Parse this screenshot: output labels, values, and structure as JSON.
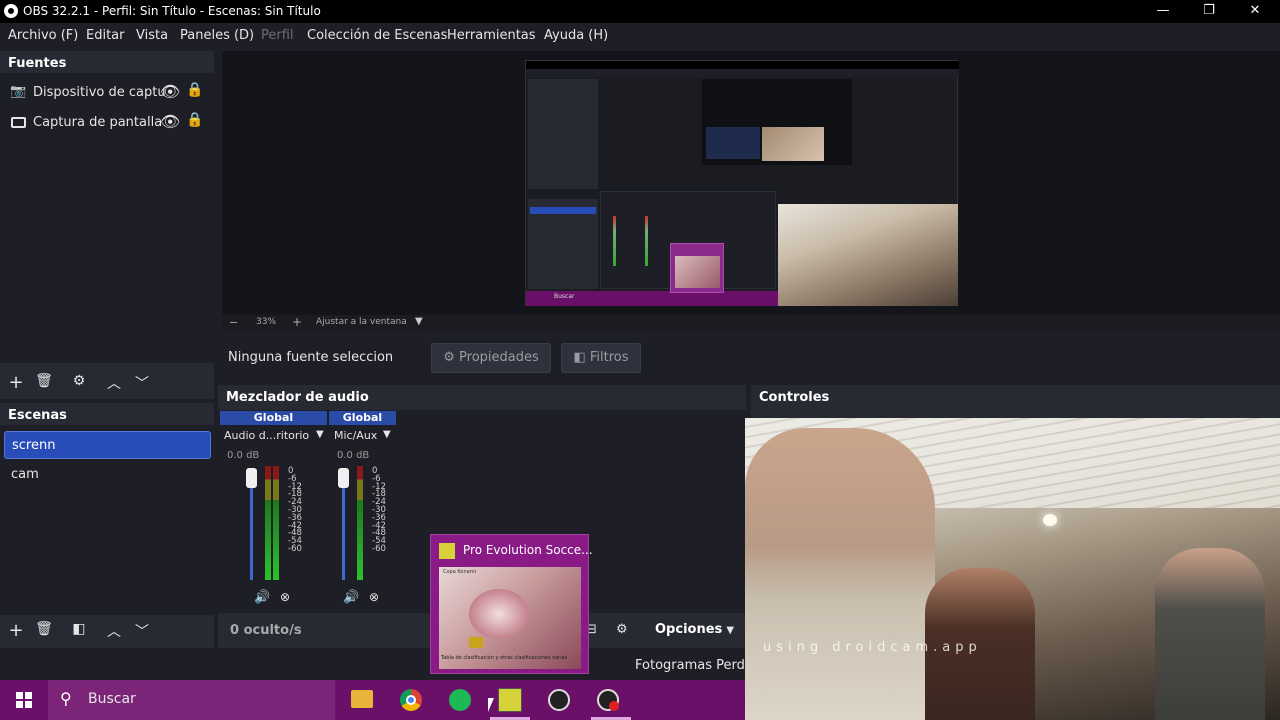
{
  "window": {
    "title": "OBS 32.2.1 - Perfil: Sin Título - Escenas: Sin Título",
    "controls": [
      "—",
      "❐",
      "✕"
    ]
  },
  "menu": {
    "items": [
      {
        "label": "Archivo (F)",
        "disabled": false
      },
      {
        "label": "Editar",
        "disabled": false
      },
      {
        "label": "Vista",
        "disabled": false
      },
      {
        "label": "Paneles (D)",
        "disabled": false
      },
      {
        "label": "Perfil",
        "disabled": true
      },
      {
        "label": "Colección de Escenas",
        "disabled": false
      },
      {
        "label": "Herramientas",
        "disabled": false
      },
      {
        "label": "Ayuda (H)",
        "disabled": false
      }
    ]
  },
  "sources": {
    "title": "Fuentes",
    "items": [
      {
        "label": "Dispositivo de captu",
        "icon": "camera-icon"
      },
      {
        "label": "Captura de pantalla",
        "icon": "monitor-icon"
      }
    ]
  },
  "scenes": {
    "title": "Escenas",
    "items": [
      {
        "label": "screnn",
        "selected": true
      },
      {
        "label": "cam",
        "selected": false
      }
    ]
  },
  "preview": {
    "zoom": "33%",
    "fit_label": "Ajustar a la ventana",
    "nested_search": "Buscar"
  },
  "source_bar": {
    "no_selection": "Ninguna fuente seleccionac",
    "properties": "Propiedades",
    "filters": "Filtros"
  },
  "mixer": {
    "title": "Mezclador de audio",
    "channels": [
      {
        "head": "Global",
        "name": "Audio d...ritorio",
        "db": "0.0 dB"
      },
      {
        "head": "Global",
        "name": "Mic/Aux",
        "db": "0.0 dB"
      }
    ],
    "scale": [
      "0",
      "-6",
      "-12",
      "-18",
      "-24",
      "-30",
      "-36",
      "-42",
      "-48",
      "-54",
      "-60"
    ],
    "hidden_count": "0 oculto/s"
  },
  "controls": {
    "title": "Controles",
    "options": "Opciones",
    "dropped_frames": "Fotogramas Perdic",
    "overlay_text": "using droidcam.app"
  },
  "thumbnail": {
    "title": "Pro Evolution Socce...",
    "inner_caption": "Copa Konami",
    "inner_small": "Tabla de clasificación y otras clasificaciones varias"
  },
  "taskbar": {
    "search_placeholder": "Buscar",
    "apps": [
      "explorer-icon",
      "chrome-icon",
      "spotify-icon",
      "pes-icon",
      "obs-icon",
      "obs-record-icon"
    ]
  },
  "colors": {
    "bg": "#1e1f26",
    "panel": "#272a33",
    "accent": "#284cb8",
    "taskbar": "#6a1068"
  }
}
